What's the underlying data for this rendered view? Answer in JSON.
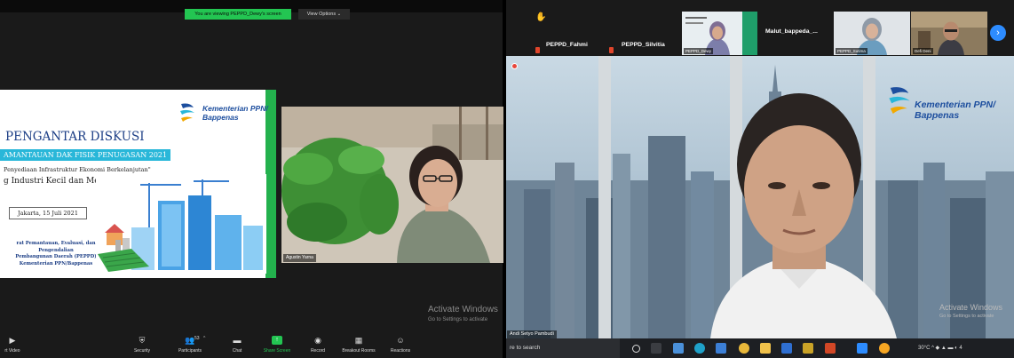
{
  "left_window": {
    "banner": "You are viewing PEPPD_Dewy's screen",
    "view_options": "View Options ⌄",
    "slide": {
      "org_line1": "Kementerian PPN/",
      "org_line2": "Bappenas",
      "title": "PENGANTAR DISKUSI",
      "band": "AMANTAUAN DAK FISIK PENUGASAN 2021",
      "line1": "Penyediaan Infrastruktur Ekonomi Berkelanjutan\"",
      "line2": "g Industri Kecil dan Menengah (IKM)",
      "date": "Jakarta, 15 Juli 2021",
      "footer": [
        "rat Pemantauan, Evaluasi, dan Pengendalian",
        "Pembangunan Daerah (PEPPD)",
        "Kementerian PPN/Bappenas"
      ]
    },
    "presenter_label": "Agustin Yarna",
    "activate_title": "Activate Windows",
    "activate_sub": "Go to Settings to activate",
    "toolbar": [
      {
        "icon": "video-off-icon",
        "glyph": "▶",
        "label": "rt Video"
      },
      {
        "icon": "security-icon",
        "glyph": "⛨",
        "label": "Security"
      },
      {
        "icon": "participants-icon",
        "glyph": "👥",
        "label": "Participants",
        "count": "53"
      },
      {
        "icon": "chat-icon",
        "glyph": "▬",
        "label": "Chat"
      },
      {
        "icon": "share-screen-icon",
        "glyph": "↑",
        "label": "Share Screen"
      },
      {
        "icon": "record-icon",
        "glyph": "◉",
        "label": "Record"
      },
      {
        "icon": "breakout-rooms-icon",
        "glyph": "▦",
        "label": "Breakout Rooms"
      },
      {
        "icon": "reactions-icon",
        "glyph": "☺",
        "label": "Reactions"
      }
    ]
  },
  "right_window": {
    "participants": [
      {
        "name": "PEPPD_Fahmi"
      },
      {
        "name": "PEPPD_Silvitia"
      },
      {
        "name": "PEPPD_Dewy",
        "thumb": true
      },
      {
        "name": "Malut_bappeda_..."
      },
      {
        "name": "PEPPD_Sutima",
        "thumb": true
      },
      {
        "name": "Defi Deni",
        "thumb": true
      }
    ],
    "main_org_line1": "Kementerian PPN/",
    "main_org_line2": "Bappenas",
    "main_label": "Andi Setyo Pambudi",
    "activate_title": "Activate Windows",
    "activate_sub": "Go to Settings to activate",
    "search_text": "re to search",
    "tray_text": "30°C  ^ ◆ ▲ ▬ ◐ 4"
  },
  "colors": {
    "zoom_green": "#23c552",
    "zoom_blue": "#2d8cff",
    "bappenas_blue": "#1d4e9e",
    "slide_cyan": "#29b7d9"
  }
}
